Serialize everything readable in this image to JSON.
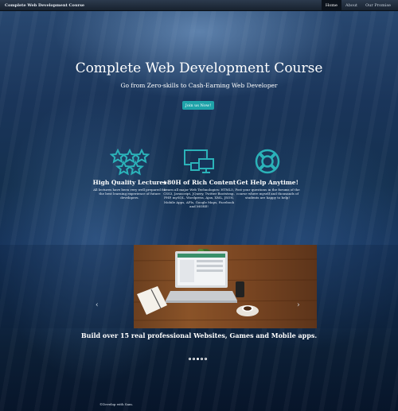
{
  "navbar": {
    "brand": "Complete Web Development Course",
    "items": [
      {
        "label": "Home",
        "active": true
      },
      {
        "label": "About",
        "active": false
      },
      {
        "label": "Our Promise",
        "active": false
      }
    ]
  },
  "hero": {
    "title": "Complete Web Development Course",
    "subtitle": "Go from Zero-skills to Cash-Earning Web Developer",
    "button_label": "Join us Now!"
  },
  "features": [
    {
      "icon": "stars-icon",
      "title": "High Quality Lectures",
      "text": "All lectures have been very well prepared for the best learning experience of future developers."
    },
    {
      "icon": "monitors-icon",
      "title": "+80H of Rich Content",
      "text": "Learn all major Web Technologies: HTML5, CSS3, Javascript, JQuery, Twitter Bootstrap, PHP, mySQL, Wordpress, Ajax, XML, JSON, Mobile Apps, APIs, Google Maps, Facebook and MORE!"
    },
    {
      "icon": "lifebuoy-icon",
      "title": "Get Help Anytime!",
      "text": "Post your questions in the forums of the course where myself and thousands of students are happy to help!"
    }
  ],
  "carousel": {
    "caption": "Build over 15 real professional Websites, Games and Mobile apps.",
    "prev_label": "‹",
    "next_label": "›",
    "slide_count": 5,
    "active_index": 2
  },
  "footer": {
    "text": "©Develop with Sam."
  },
  "colors": {
    "accent": "#1fa3a9",
    "navbar": "#1f2a38"
  }
}
